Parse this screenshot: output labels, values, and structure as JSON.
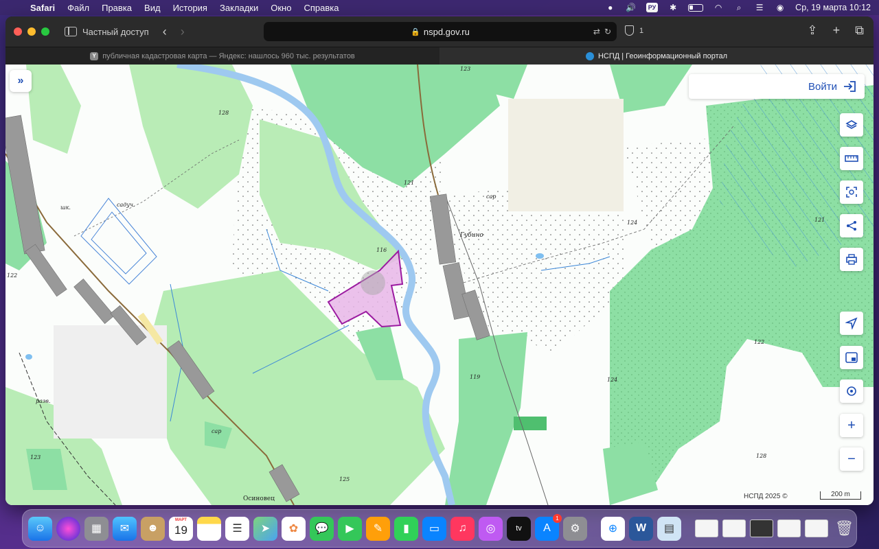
{
  "menubar": {
    "app": "Safari",
    "items": [
      "Файл",
      "Правка",
      "Вид",
      "История",
      "Закладки",
      "Окно",
      "Справка"
    ],
    "input_language": "РУ",
    "datetime": "Ср, 19 марта  10:12"
  },
  "browser": {
    "private_label": "Частный доступ",
    "url": "nspd.gov.ru",
    "tracker_count": "1",
    "tabs": [
      {
        "title": "публичная кадастровая карта — Яндекс: нашлось 960 тыс. результатов",
        "favicon": "Y"
      },
      {
        "title": "НСПД | Геоинформационный портал",
        "favicon": ""
      }
    ]
  },
  "map": {
    "login_label": "Войти",
    "credit": "НСПД 2025 ©",
    "scale_label": "200 m",
    "labels": {
      "l128a": "128",
      "l123a": "123",
      "l121": "121",
      "l124": "124",
      "l116": "116",
      "l122": "122",
      "l119": "119",
      "l125": "125",
      "l123b": "123",
      "l121b": "121",
      "l122b": "122",
      "l124b": "124",
      "l128b": "128",
      "gubino": "Губино",
      "sar1": "сар",
      "sar2": "сар",
      "sadyuch": "садуч.",
      "shk": "шк.",
      "razv": "разв.",
      "osinovets": "Осиновец"
    },
    "controls": [
      "layers-icon",
      "ruler-icon",
      "select-area-icon",
      "share-icon",
      "print-icon",
      "navigate-icon",
      "picture-in-picture-icon",
      "locate-icon",
      "zoom-in-icon",
      "zoom-out-icon"
    ],
    "colors": {
      "forest": "#8de0a6",
      "light_forest": "#b6ecb4",
      "river": "#9ec9f0",
      "parcel": "#e8b6e8",
      "parcel_border": "#9b1aa0"
    }
  },
  "dock": {
    "apps": [
      "Finder",
      "Siri",
      "Launchpad",
      "Mail",
      "Contacts",
      "Calendar",
      "Notes",
      "Reminders",
      "Maps",
      "Photos",
      "Messages",
      "FaceTime",
      "Pages",
      "Numbers",
      "Keynote",
      "Music",
      "Podcasts",
      "TV",
      "App Store",
      "System Settings",
      "Safari",
      "Word",
      "Preview"
    ],
    "calendar_month": "МАРТ",
    "calendar_day": "19",
    "appstore_badge": "1"
  }
}
